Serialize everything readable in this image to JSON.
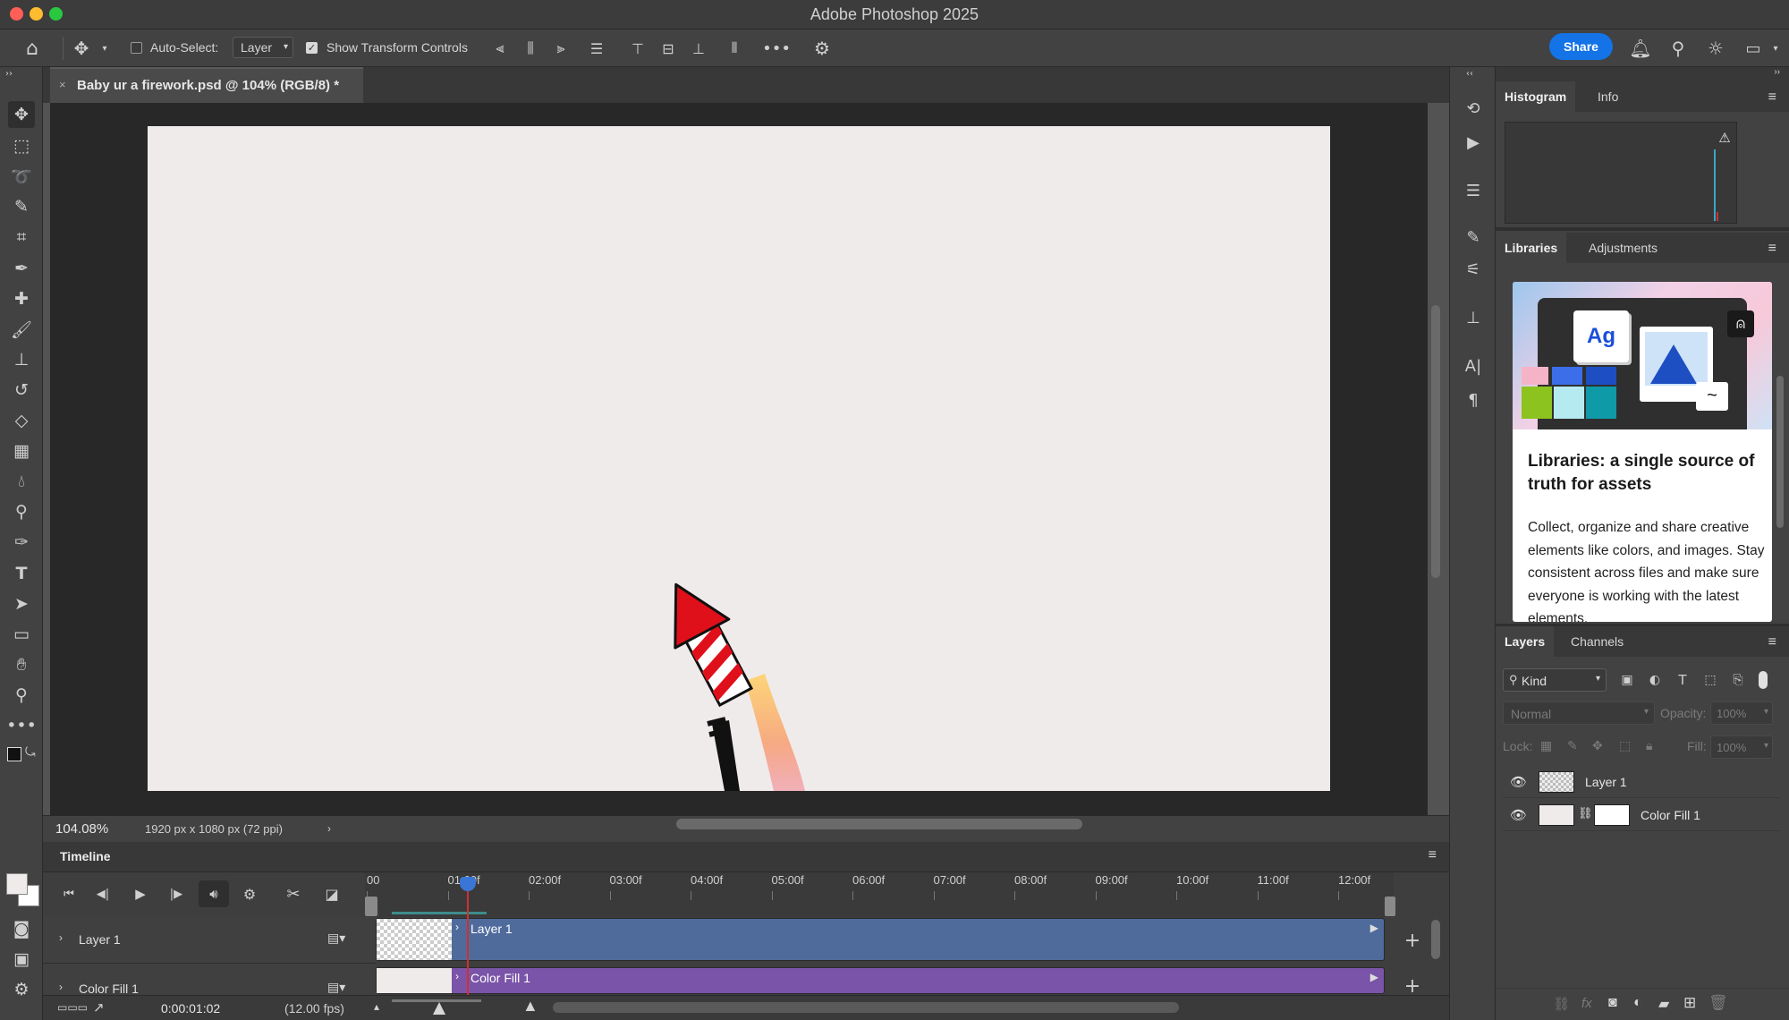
{
  "window": {
    "title": "Adobe Photoshop 2025"
  },
  "options": {
    "auto_select_label": "Auto-Select:",
    "auto_select_value": "Layer",
    "show_transform_label": "Show Transform Controls",
    "share_label": "Share"
  },
  "document": {
    "tab_title": "Baby ur a firework.psd @ 104% (RGB/8) *",
    "zoom": "104.08%",
    "info": "1920 px x 1080 px (72 ppi)"
  },
  "timeline": {
    "title": "Timeline",
    "timecode": "0:00:01:02",
    "fps": "(12.00 fps)",
    "ticks": [
      "00",
      "01:00f",
      "02:00f",
      "03:00f",
      "04:00f",
      "05:00f",
      "06:00f",
      "07:00f",
      "08:00f",
      "09:00f",
      "10:00f",
      "11:00f",
      "12:00f"
    ],
    "tracks": [
      {
        "name": "Layer 1",
        "clip": "Layer 1",
        "color": "#4f6b9c"
      },
      {
        "name": "Color Fill 1",
        "clip": "Color Fill 1",
        "color": "#7a54a8"
      }
    ]
  },
  "panels": {
    "histogram_tabs": [
      "Histogram",
      "Info"
    ],
    "library_tabs": [
      "Libraries",
      "Adjustments"
    ],
    "library_card": {
      "art_text": "Ag",
      "title": "Libraries: a single source of truth for assets",
      "body": "Collect, organize and share creative elements like colors, and images. Stay consistent across files and make sure everyone is working with the latest elements."
    },
    "layers_tabs": [
      "Layers",
      "Channels"
    ],
    "filter_kind": "Kind",
    "blend_mode": "Normal",
    "opacity_label": "Opacity:",
    "opacity_value": "100%",
    "lock_label": "Lock:",
    "fill_label": "Fill:",
    "fill_value": "100%",
    "layers": [
      {
        "name": "Layer 1"
      },
      {
        "name": "Color Fill 1"
      }
    ]
  },
  "colors": {
    "accent": "#1473e6",
    "canvas": "#efebea",
    "rocket_red": "#e0101a",
    "playhead": "#d03030"
  }
}
